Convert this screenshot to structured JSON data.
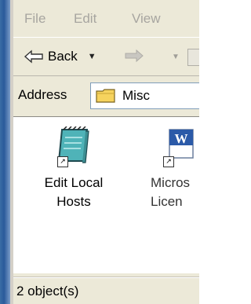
{
  "menu": {
    "file": "File",
    "edit": "Edit",
    "view": "View"
  },
  "toolbar": {
    "back_label": "Back"
  },
  "address": {
    "label": "Address",
    "value": "Misc"
  },
  "items": [
    {
      "line1": "Edit Local",
      "line2": "Hosts"
    },
    {
      "line1": "Micros",
      "line2": "Licen"
    }
  ],
  "status": {
    "text": "2 object(s)"
  },
  "colors": {
    "frame_blue": "#3a6ea5",
    "chrome": "#ece9d8",
    "notepad_teal": "#4fb3b8",
    "word_blue": "#2b5aa8"
  }
}
